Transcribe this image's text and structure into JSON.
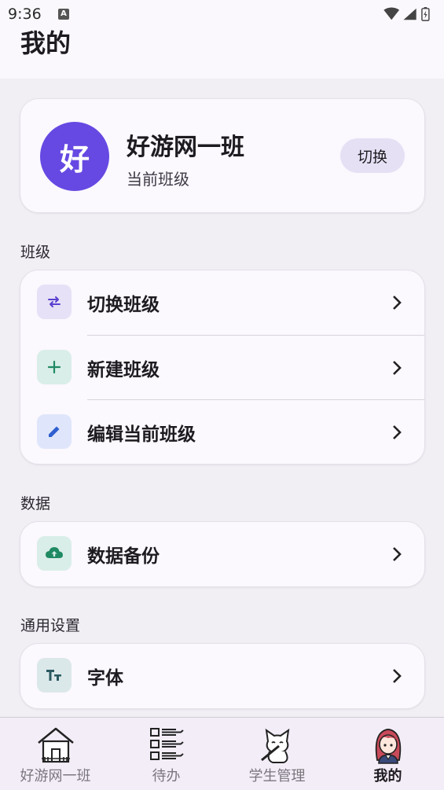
{
  "status_bar": {
    "time": "9:36",
    "notification_glyph": "A"
  },
  "header": {
    "title": "我的"
  },
  "profile": {
    "avatar_char": "好",
    "class_name": "好游网一班",
    "subtitle": "当前班级",
    "switch_label": "切换",
    "avatar_color": "#6649e2"
  },
  "sections": {
    "class": {
      "title": "班级",
      "items": [
        {
          "label": "切换班级",
          "icon": "swap-icon"
        },
        {
          "label": "新建班级",
          "icon": "plus-icon"
        },
        {
          "label": "编辑当前班级",
          "icon": "pencil-icon"
        }
      ]
    },
    "data": {
      "title": "数据",
      "items": [
        {
          "label": "数据备份",
          "icon": "cloud-upload-icon"
        }
      ]
    },
    "general": {
      "title": "通用设置",
      "items": [
        {
          "label": "字体",
          "icon": "font-size-icon"
        }
      ]
    }
  },
  "bottom_nav": {
    "items": [
      {
        "label": "好游网一班",
        "icon": "house-icon",
        "active": false
      },
      {
        "label": "待办",
        "icon": "checklist-icon",
        "active": false
      },
      {
        "label": "学生管理",
        "icon": "cat-student-icon",
        "active": false
      },
      {
        "label": "我的",
        "icon": "girl-avatar-icon",
        "active": true
      }
    ]
  }
}
